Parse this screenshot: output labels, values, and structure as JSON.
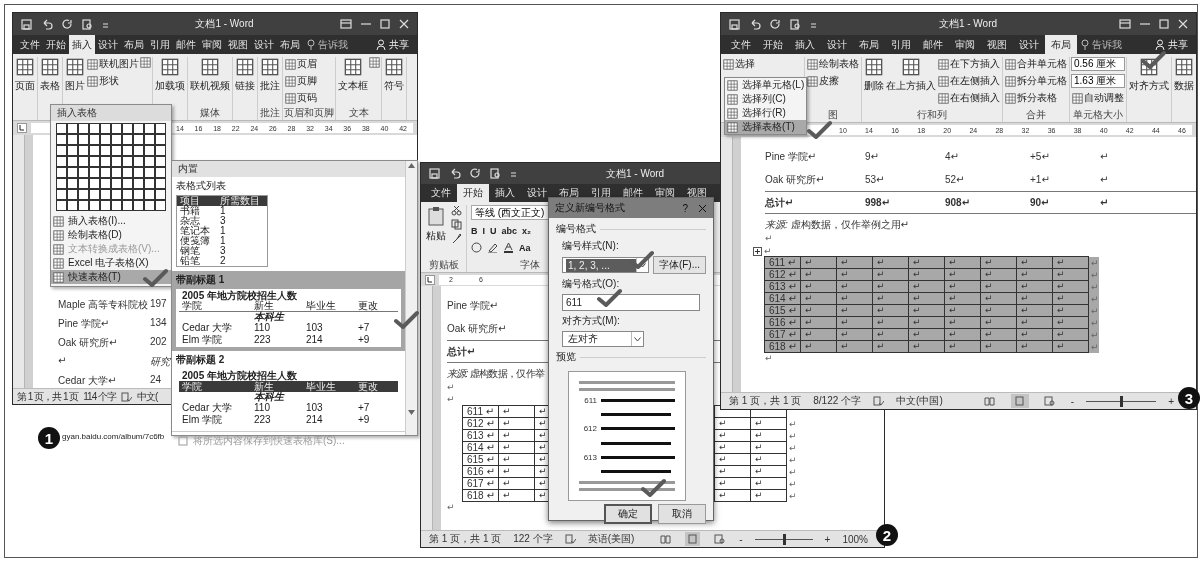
{
  "window_1": {
    "title": "文档1 - Word",
    "tabs": [
      {
        "label": "文件",
        "selected": false
      },
      {
        "label": "开始",
        "selected": false
      },
      {
        "label": "插入",
        "selected": true
      },
      {
        "label": "设计",
        "selected": false
      },
      {
        "label": "布局",
        "selected": false
      },
      {
        "label": "引用",
        "selected": false
      },
      {
        "label": "邮件",
        "selected": false
      },
      {
        "label": "审阅",
        "selected": false
      },
      {
        "label": "视图",
        "selected": false
      },
      {
        "label": "设计",
        "selected": false
      },
      {
        "label": "布局",
        "selected": false
      }
    ],
    "tell_me": "告诉我",
    "share": "共享",
    "ribbon": [
      {
        "items": [
          {
            "kind": "big",
            "text": "页面"
          }
        ]
      },
      {
        "items": [
          {
            "kind": "big",
            "text": "表格"
          }
        ]
      },
      {
        "items": [
          {
            "kind": "big",
            "text": "图片"
          },
          {
            "kind": "small",
            "text": "联机图片"
          },
          {
            "kind": "small",
            "text": "形状"
          },
          {
            "kind": "icon"
          }
        ]
      },
      {
        "items": [
          {
            "kind": "big",
            "text": "加载项"
          }
        ]
      },
      {
        "label": "媒体",
        "items": [
          {
            "kind": "big",
            "text": "联机视频"
          }
        ]
      },
      {
        "items": [
          {
            "kind": "big",
            "text": "链接"
          }
        ]
      },
      {
        "label": "批注",
        "items": [
          {
            "kind": "big",
            "text": "批注"
          }
        ]
      },
      {
        "label": "页眉和页脚",
        "items": [
          {
            "kind": "small",
            "text": "页眉"
          },
          {
            "kind": "small",
            "text": "页脚"
          },
          {
            "kind": "small",
            "text": "页码"
          }
        ]
      },
      {
        "label": "文本",
        "items": [
          {
            "kind": "big",
            "text": "文本框"
          },
          {
            "kind": "icon"
          }
        ]
      },
      {
        "items": [
          {
            "kind": "big",
            "text": "符号"
          }
        ]
      }
    ],
    "ruler_marks": [
      "14",
      "16",
      "18",
      "22",
      "24",
      "26",
      "28",
      "32",
      "34",
      "36",
      "38",
      "40",
      "42"
    ],
    "document_rows": [
      {
        "kind": "data",
        "name": "Maple 高等专科院校",
        "value": "197"
      },
      {
        "kind": "data",
        "name": "Pine 学院↵",
        "value": "134"
      },
      {
        "kind": "data",
        "name": "Oak 研究所↵",
        "value": "202"
      },
      {
        "kind": "subheading",
        "name": "↵",
        "value": "研究"
      },
      {
        "kind": "data",
        "name": "Cedar 大学↵",
        "value": "24"
      }
    ],
    "status": [
      "第 1 页，共 1 页",
      "114 个字",
      "中文("
    ]
  },
  "table_menu": {
    "title": "插入表格",
    "items": [
      {
        "label": "插入表格(I)...",
        "disabled": false,
        "selected": false
      },
      {
        "label": "绘制表格(D)",
        "disabled": false,
        "selected": false
      },
      {
        "label": "文本转换成表格(V)...",
        "disabled": true,
        "selected": false
      },
      {
        "label": "Excel 电子表格(X)",
        "disabled": false,
        "selected": false
      },
      {
        "label": "快速表格(T)",
        "disabled": false,
        "selected": true
      }
    ]
  },
  "quick_tables": {
    "heading": "内置",
    "sections": [
      {
        "kind": "list",
        "title": "表格式列表",
        "selected": false,
        "dark_header": true,
        "columns": [
          "项目",
          "所需数目"
        ],
        "rows": [
          [
            "书籍",
            "1"
          ],
          [
            "杂志",
            "3"
          ],
          [
            "笔记本",
            "1"
          ],
          [
            "便笺簿",
            "1"
          ],
          [
            "钢笔",
            "3"
          ],
          [
            "铅笔",
            "2"
          ]
        ]
      },
      {
        "kind": "subheading",
        "title": "带副标题 1",
        "selected": true,
        "dark_header": false,
        "caption": "2005 年地方院校招生人数",
        "columns": [
          "学院",
          "新生",
          "毕业生",
          "更改"
        ],
        "subheading": "本科生",
        "rows": [
          [
            "Cedar 大学",
            "110",
            "103",
            "+7"
          ],
          [
            "Elm 学院",
            "223",
            "214",
            "+9"
          ]
        ]
      },
      {
        "kind": "subheading",
        "title": "带副标题 2",
        "selected": false,
        "dark_header": true,
        "caption": "2005 年地方院校招生人数",
        "columns": [
          "学院",
          "新生",
          "毕业生",
          "更改"
        ],
        "subheading": "本科生",
        "rows": [
          [
            "Cedar 大学",
            "110",
            "103",
            "+7"
          ],
          [
            "Elm 学院",
            "223",
            "214",
            "+9"
          ]
        ]
      }
    ],
    "footer": "将所选内容保存到快速表格库(S)..."
  },
  "url": "gyan.baidu.com/album/7c6fb",
  "window_2": {
    "title": "文档1 - Word",
    "tabs": [
      {
        "label": "文件",
        "selected": false
      },
      {
        "label": "开始",
        "selected": true
      },
      {
        "label": "插入",
        "selected": false
      },
      {
        "label": "设计",
        "selected": false
      },
      {
        "label": "布局",
        "selected": false
      },
      {
        "label": "引用",
        "selected": false
      },
      {
        "label": "邮件",
        "selected": false
      },
      {
        "label": "审阅",
        "selected": false
      },
      {
        "label": "视图",
        "selected": false
      }
    ],
    "paste": "粘贴",
    "clipboard": "剪贴板",
    "font_name": "等线 (西文正文)",
    "format_buttons": [
      "B",
      "I",
      "U",
      "abc",
      "x₂"
    ],
    "case_button": "Aa",
    "font_group": "字体",
    "ruler_marks": [
      "2",
      "6"
    ],
    "document_rows": [
      {
        "kind": "data",
        "name": "Pine 学院↵"
      },
      {
        "kind": "data",
        "name": "Oak 研究所↵"
      },
      {
        "kind": "total",
        "name": "总计↵"
      }
    ],
    "source": "*来源:* 虚构数据，仅作举",
    "paragraph_marks": [
      "↵",
      "↵"
    ],
    "table_rows": [
      {
        "label": "611 ↵",
        "cells": [
          "↵",
          "↵"
        ]
      },
      {
        "label": "612 ↵",
        "cells": [
          "↵",
          "↵"
        ],
        "right_cells": [
          "↵",
          "↵"
        ],
        "end": "↵"
      },
      {
        "label": "613 ↵",
        "cells": [
          "↵",
          "↵"
        ],
        "right_cells": [
          "↵",
          "↵"
        ],
        "end": "↵"
      },
      {
        "label": "614 ↵",
        "cells": [
          "↵",
          "↵"
        ],
        "right_cells": [
          "↵",
          "↵"
        ],
        "end": "↵"
      },
      {
        "label": "615 ↵",
        "cells": [
          "↵",
          "↵"
        ],
        "right_cells": [
          "↵",
          "↵"
        ],
        "end": "↵"
      },
      {
        "label": "616 ↵",
        "cells": [
          "↵",
          "↵"
        ],
        "right_cells": [
          "↵",
          "↵"
        ],
        "end": "↵"
      },
      {
        "label": "617 ↵",
        "cells": [
          "↵",
          "↵"
        ],
        "right_cells": [
          "↵",
          "↵"
        ],
        "end": "↵"
      },
      {
        "label": "618 ↵",
        "cells": [
          "↵",
          "↵"
        ],
        "right_cells": [
          "↵",
          "↵"
        ],
        "end": "↵"
      }
    ],
    "after_table": "↵",
    "status": [
      "第 1 页，共 1 页",
      "122 个字",
      "英语(美国)"
    ],
    "zoom": {
      "minus": "-",
      "plus": "+",
      "percent": "100%",
      "level": 0.5
    }
  },
  "dialog": {
    "title": "定义新编号格式",
    "help": "?",
    "section": "编号格式",
    "style_label": "编号样式(N):",
    "style_value": "1, 2, 3, ...",
    "font_button": "字体(F)...",
    "format_label": "编号格式(O):",
    "format_value": "611",
    "align_label": "对齐方式(M):",
    "align_value": "左对齐",
    "preview_label": "预览",
    "preview_numbers": [
      "611",
      "612",
      "613"
    ],
    "buttons": [
      {
        "label": "确定",
        "default": true
      },
      {
        "label": "取消",
        "default": false
      }
    ]
  },
  "window_3": {
    "title": "文档1 - Word",
    "tabs": [
      {
        "label": "文件",
        "selected": false
      },
      {
        "label": "开始",
        "selected": false
      },
      {
        "label": "插入",
        "selected": false
      },
      {
        "label": "设计",
        "selected": false
      },
      {
        "label": "布局",
        "selected": false
      },
      {
        "label": "引用",
        "selected": false
      },
      {
        "label": "邮件",
        "selected": false
      },
      {
        "label": "审阅",
        "selected": false
      },
      {
        "label": "视图",
        "selected": false
      },
      {
        "label": "设计",
        "selected": false
      },
      {
        "label": "布局",
        "selected": true
      }
    ],
    "tell_me": "告诉我",
    "share": "共享",
    "ribbon": [
      {
        "items": [
          {
            "kind": "small",
            "text": "选择"
          }
        ]
      },
      {
        "label": "图",
        "items": [
          {
            "kind": "small",
            "text": "绘制表格"
          },
          {
            "kind": "small",
            "text": "皮擦"
          }
        ]
      },
      {
        "label": "行和列",
        "items": [
          {
            "kind": "big",
            "text": "删除"
          },
          {
            "kind": "big",
            "text": "在上方插入"
          },
          {
            "kind": "small",
            "text": "在下方插入"
          },
          {
            "kind": "small",
            "text": "在左侧插入"
          },
          {
            "kind": "small",
            "text": "在右侧插入"
          }
        ]
      },
      {
        "label": "合并",
        "items": [
          {
            "kind": "small",
            "text": "合并单元格"
          },
          {
            "kind": "small",
            "text": "拆分单元格"
          },
          {
            "kind": "small",
            "text": "拆分表格"
          }
        ]
      },
      {
        "label": "单元格大小",
        "items": [
          {
            "kind": "spin",
            "text": "0.56 厘米"
          },
          {
            "kind": "spin",
            "text": "1.63 厘米"
          },
          {
            "kind": "small",
            "text": "自动调整"
          }
        ]
      },
      {
        "items": [
          {
            "kind": "big",
            "text": "对齐方式"
          }
        ]
      },
      {
        "items": [
          {
            "kind": "big",
            "text": "数据"
          }
        ]
      }
    ],
    "ruler_marks": [
      "10",
      "14",
      "16",
      "18",
      "20",
      "24",
      "28",
      "32",
      "36",
      "38",
      "40",
      "42",
      "44",
      "46"
    ],
    "document_rows": [
      {
        "kind": "data",
        "cells": [
          "Pine 学院↵",
          "9↵",
          "4↵",
          "+5↵",
          "↵"
        ]
      },
      {
        "kind": "data",
        "cells": [
          "Oak 研究所↵",
          "53↵",
          "52↵",
          "+1↵",
          "↵"
        ]
      },
      {
        "kind": "total",
        "cells": [
          "总计↵",
          "998↵",
          "908↵",
          "90↵",
          "↵"
        ]
      }
    ],
    "source": "*来源:* 虚构数据，仅作举例之用↵",
    "paragraph_marks": [
      "↵",
      "↵"
    ],
    "table_selected": true,
    "table_rows": [
      {
        "label": "611 ↵",
        "cells": [
          "↵",
          "↵",
          "↵",
          "↵",
          "↵",
          "↵",
          "↵",
          "↵"
        ],
        "end": "↵"
      },
      {
        "label": "612 ↵",
        "cells": [
          "↵",
          "↵",
          "↵",
          "↵",
          "↵",
          "↵",
          "↵",
          "↵"
        ],
        "end": "↵"
      },
      {
        "label": "613 ↵",
        "cells": [
          "↵",
          "↵",
          "↵",
          "↵",
          "↵",
          "↵",
          "↵",
          "↵"
        ],
        "end": "↵"
      },
      {
        "label": "614 ↵",
        "cells": [
          "↵",
          "↵",
          "↵",
          "↵",
          "↵",
          "↵",
          "↵",
          "↵"
        ],
        "end": "↵"
      },
      {
        "label": "615 ↵",
        "cells": [
          "↵",
          "↵",
          "↵",
          "↵",
          "↵",
          "↵",
          "↵",
          "↵"
        ],
        "end": "↵"
      },
      {
        "label": "616 ↵",
        "cells": [
          "↵",
          "↵",
          "↵",
          "↵",
          "↵",
          "↵",
          "↵",
          "↵"
        ],
        "end": "↵"
      },
      {
        "label": "617 ↵",
        "cells": [
          "↵",
          "↵",
          "↵",
          "↵",
          "↵",
          "↵",
          "↵",
          "↵"
        ],
        "end": "↵"
      },
      {
        "label": "618 ↵",
        "cells": [
          "↵",
          "↵",
          "↵",
          "↵",
          "↵",
          "↵",
          "↵",
          "↵"
        ],
        "end": "↵"
      }
    ],
    "after_table": "↵",
    "status": [
      "第 1 页，共 1 页",
      "8/122 个字",
      "中文(中国)"
    ],
    "zoom": {
      "minus": "-",
      "plus": "+",
      "level": 0.5
    }
  },
  "select_menu": {
    "items": [
      {
        "label": "选择单元格(L)",
        "selected": false
      },
      {
        "label": "选择列(C)",
        "selected": false
      },
      {
        "label": "选择行(R)",
        "selected": false
      },
      {
        "label": "选择表格(T)",
        "selected": true
      }
    ]
  },
  "badges": [
    "1",
    "2",
    "3"
  ]
}
